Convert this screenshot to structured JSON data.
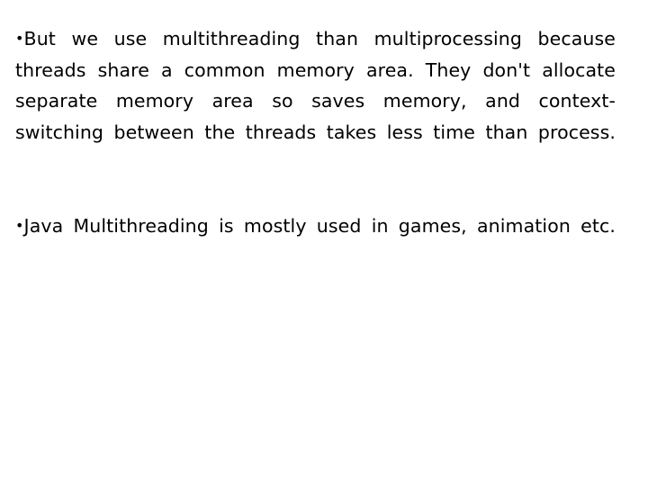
{
  "slide": {
    "background_color": "#ffffff",
    "text_color": "#000000",
    "bullets": [
      {
        "marker": "•",
        "text": "But we use multithreading than multiprocessing because threads share a common memory area. They don't allocate separate memory area so saves memory, and context-switching between the threads takes less time than process."
      },
      {
        "marker": "•",
        "text": "Java Multithreading is mostly used in games, animation etc."
      }
    ]
  }
}
